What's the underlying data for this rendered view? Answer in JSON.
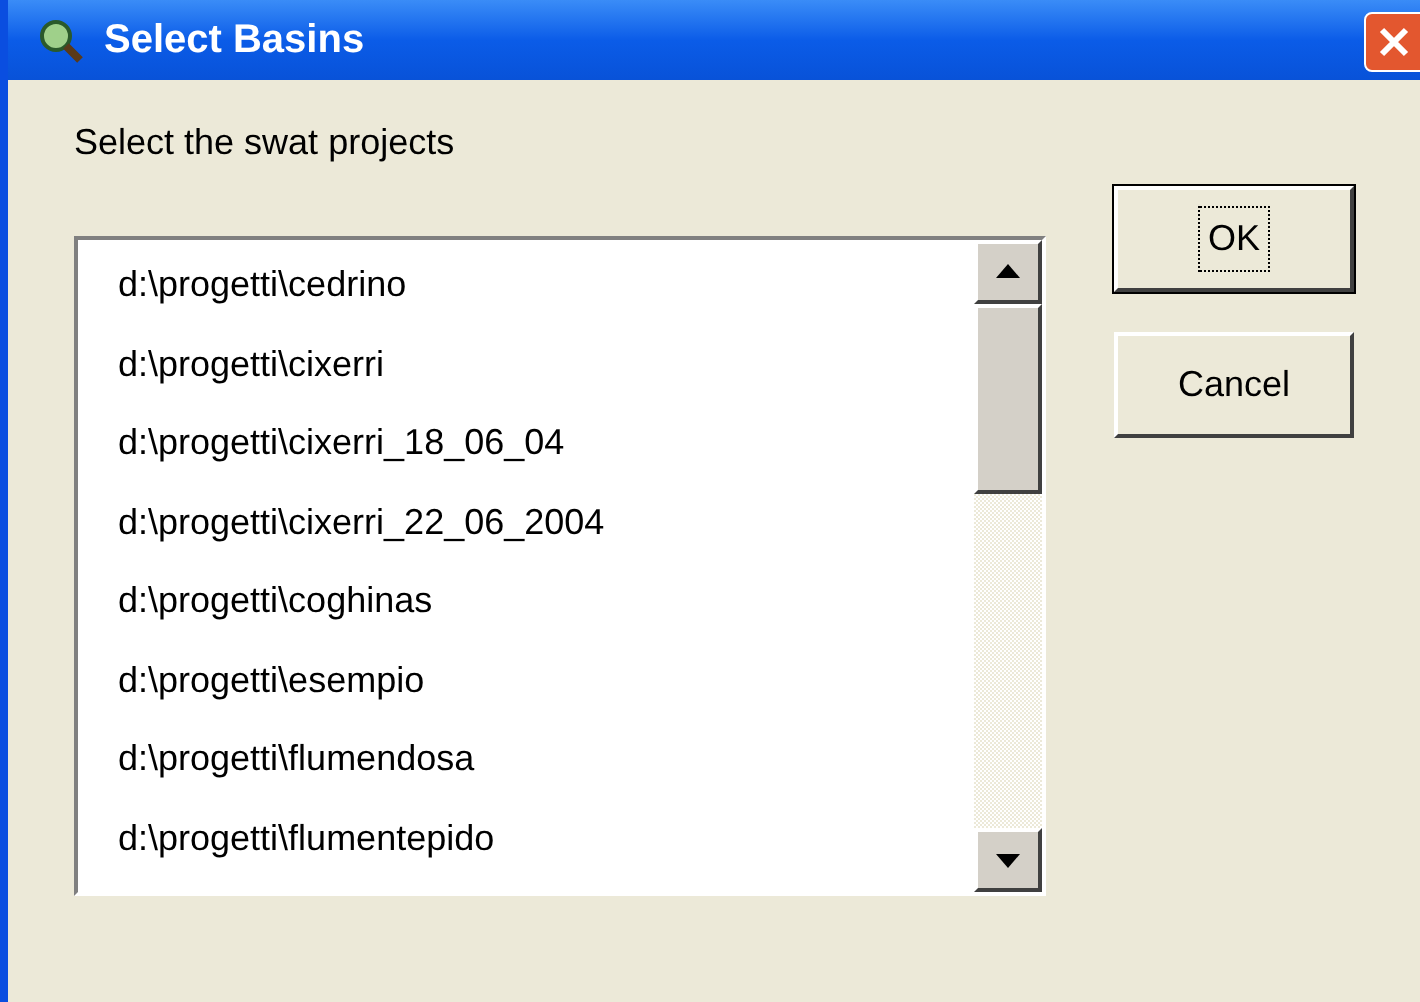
{
  "window": {
    "title": "Select Basins"
  },
  "prompt": "Select the swat projects",
  "buttons": [
    {
      "label": "OK",
      "focused": true
    },
    {
      "label": "Cancel",
      "focused": false
    }
  ],
  "projects": [
    {
      "label": "d:\\progetti\\cedrino",
      "selected": false
    },
    {
      "label": "d:\\progetti\\cixerri",
      "selected": false
    },
    {
      "label": "d:\\progetti\\cixerri_18_06_04",
      "selected": false
    },
    {
      "label": "d:\\progetti\\cixerri_22_06_2004",
      "selected": false
    },
    {
      "label": "d:\\progetti\\coghinas",
      "selected": false
    },
    {
      "label": "d:\\progetti\\esempio",
      "selected": false
    },
    {
      "label": "d:\\progetti\\flumendosa",
      "selected": false
    },
    {
      "label": "d:\\progetti\\flumentepido",
      "selected": false
    }
  ]
}
